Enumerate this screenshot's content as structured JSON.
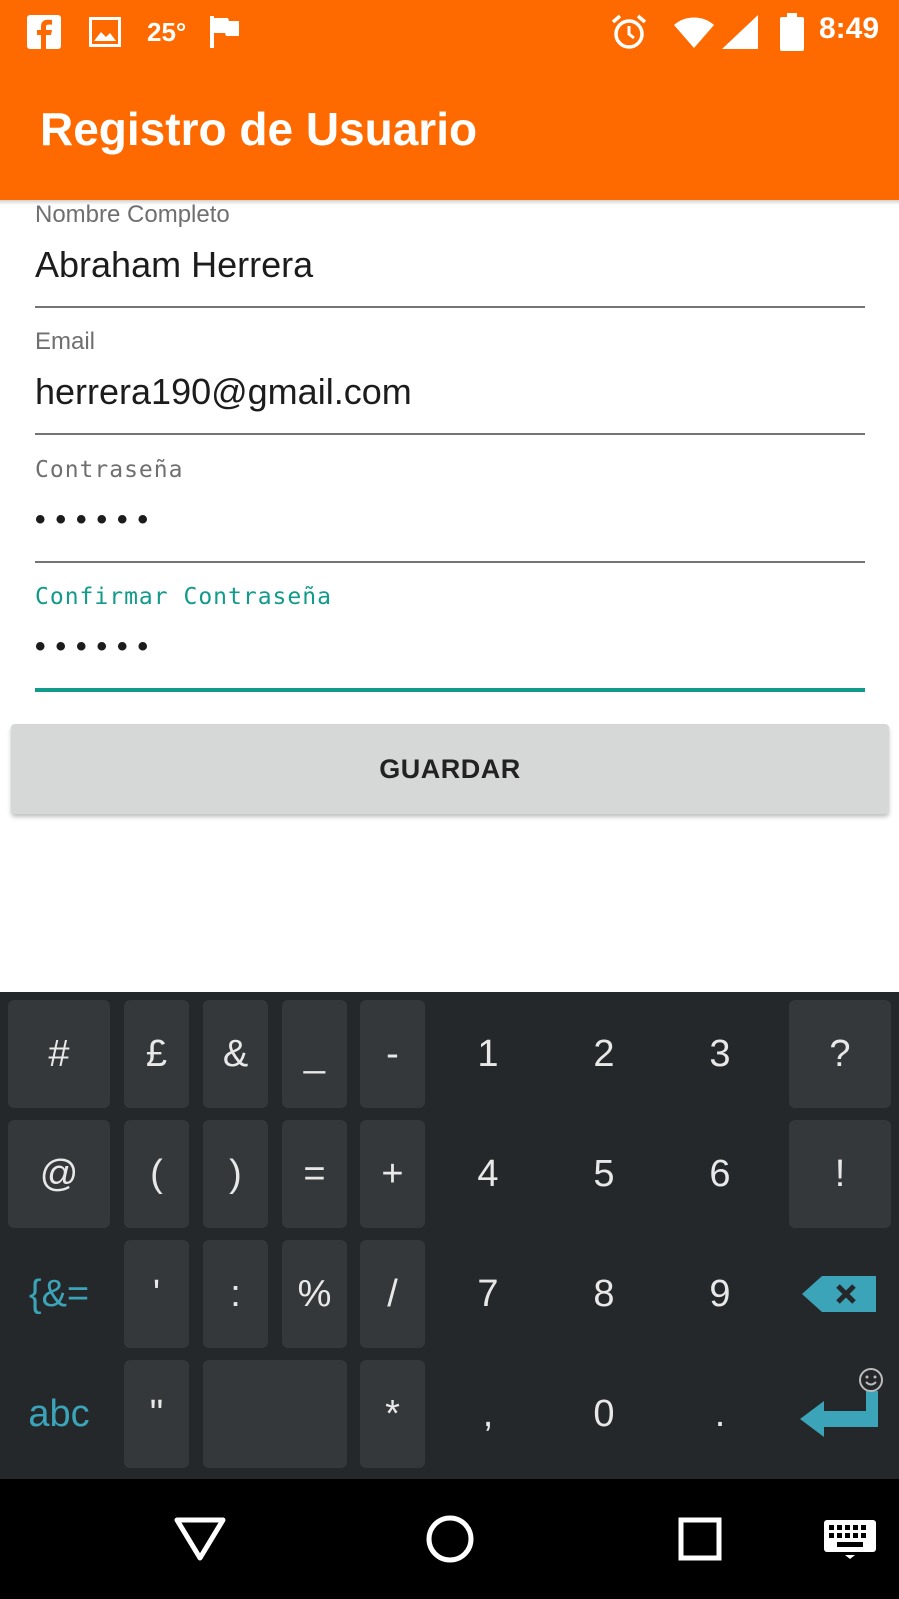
{
  "status_bar": {
    "icons": [
      "facebook-icon",
      "image-icon",
      "flag-icon",
      "alarm-icon",
      "wifi-icon",
      "signal-icon",
      "battery-icon"
    ],
    "temperature": "25°",
    "time": "8:49"
  },
  "app_bar": {
    "title": "Registro de Usuario",
    "color": "#ff6a00"
  },
  "form": {
    "name": {
      "label": "Nombre Completo",
      "value": "Abraham Herrera"
    },
    "email": {
      "label": "Email",
      "value": "herrera190@gmail.com"
    },
    "password": {
      "label": "Contraseña",
      "value": "••••••"
    },
    "confirm_password": {
      "label": "Confirmar Contraseña",
      "value": "••••••",
      "focused": true
    }
  },
  "save_button": {
    "label": "GUARDAR"
  },
  "keyboard": {
    "row1": [
      "#",
      "£",
      "&",
      "_",
      "-",
      "1",
      "2",
      "3",
      "?"
    ],
    "row2": [
      "@",
      "(",
      ")",
      "=",
      "+",
      "4",
      "5",
      "6",
      "!"
    ],
    "row3": [
      "{&=",
      "'",
      ":",
      "%",
      "/",
      "7",
      "8",
      "9"
    ],
    "row4": [
      "abc",
      "\"",
      "*",
      ",",
      "0",
      "."
    ],
    "accent_color": "#3ba4b8",
    "special_icons": [
      "backspace-icon",
      "enter-icon",
      "emoji-icon"
    ]
  },
  "nav_bar": {
    "icons": [
      "back-icon",
      "home-icon",
      "recents-icon",
      "keyboard-icon"
    ]
  }
}
